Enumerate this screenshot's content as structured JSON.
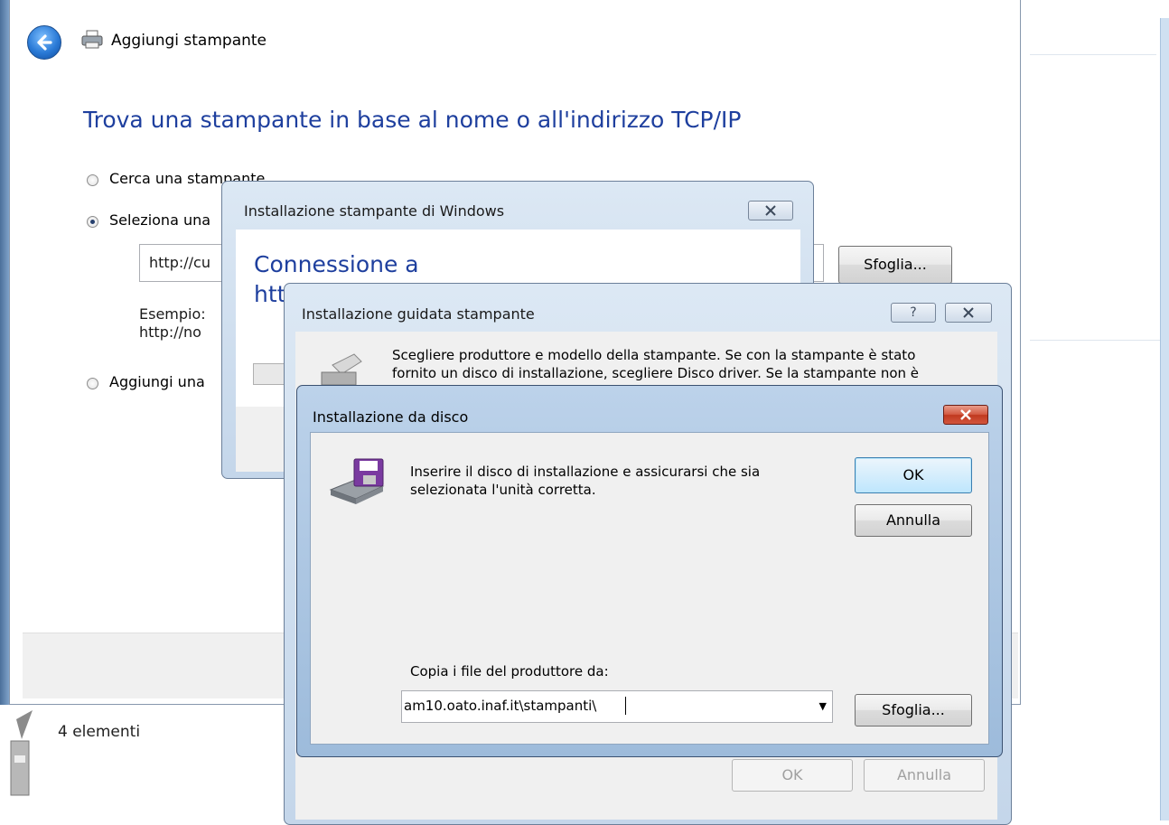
{
  "explorer": {
    "status_text": "4 elementi"
  },
  "add_printer": {
    "title": "Aggiungi stampante",
    "heading": "Trova una stampante in base al nome o all'indirizzo TCP/IP",
    "options": [
      {
        "label": "Cerca una stampante",
        "selected": false
      },
      {
        "label": "Seleziona una",
        "selected": true
      },
      {
        "label": "Aggiungi una",
        "selected": false
      }
    ],
    "url_value": "http://cu",
    "browse_label": "Sfoglia...",
    "example_line1": "Esempio:",
    "example_line2": "http://no"
  },
  "windows_printer_install": {
    "title": "Installazione stampante di Windows",
    "heading_line1": "Connessione a",
    "heading_line2": "htt"
  },
  "printer_wizard": {
    "title": "Installazione guidata stampante",
    "help_glyph": "?",
    "text_line1": "Scegliere produttore e modello della stampante. Se con la stampante è stato",
    "text_line2": "fornito un disco di installazione, scegliere Disco driver. Se la stampante non è",
    "ok_label": "OK",
    "cancel_label": "Annulla"
  },
  "install_from_disk": {
    "title": "Installazione da disco",
    "message": "Inserire il disco di installazione e assicurarsi che sia selezionata l'unità corretta.",
    "ok_label": "OK",
    "cancel_label": "Annulla",
    "copy_label": "Copia i file del produttore da:",
    "path_value": "am10.oato.inaf.it\\stampanti\\",
    "browse_label": "Sfoglia..."
  },
  "colors": {
    "heading_blue": "#1e3f9e",
    "close_red": "#c0391f",
    "frame_blue": "#c4d6ea"
  },
  "icons": [
    "back-arrow-icon",
    "printer-icon",
    "close-icon",
    "help-icon",
    "disk-drive-icon",
    "dropdown-arrow-icon"
  ]
}
